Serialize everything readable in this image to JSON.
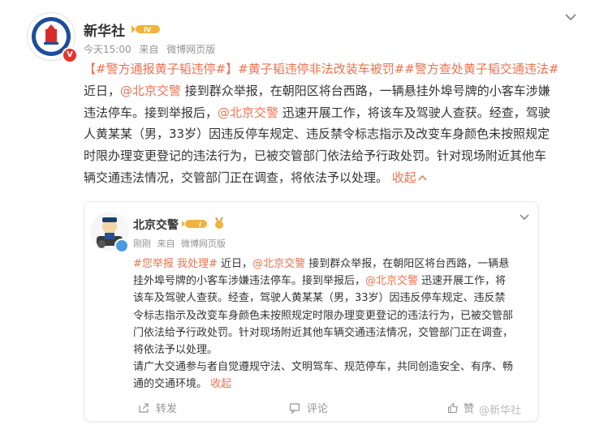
{
  "post": {
    "author": "新华社",
    "level_badge": "IV",
    "meta": {
      "time": "今天15:00",
      "source_prefix": "来自",
      "source": "微博网页版"
    },
    "text_lines": [
      [
        {
          "type": "tag",
          "text": "【#警方通报黄子韬违停#】"
        },
        {
          "type": "tag",
          "text": "#黄子韬违停非法改装车被罚#"
        },
        {
          "type": "tag",
          "text": "#警方查处黄子韬交通违法#"
        }
      ],
      [
        {
          "type": "text",
          "text": "近日，"
        },
        {
          "type": "link",
          "text": "@北京交警"
        },
        {
          "type": "text",
          "text": " 接到群众举报，在朝阳区将台西路，一辆悬挂外埠号牌的小客车涉嫌"
        }
      ],
      [
        {
          "type": "text",
          "text": "违法停车。接到举报后，"
        },
        {
          "type": "link",
          "text": "@北京交警"
        },
        {
          "type": "text",
          "text": " 迅速开展工作，将该车及驾驶人查获。经查，驾驶"
        }
      ],
      [
        {
          "type": "text",
          "text": "人黄某某（男，33岁）因违反停车规定、违反禁令标志指示及改变车身颜色未按照规定"
        }
      ],
      [
        {
          "type": "text",
          "text": "时限办理变更登记的违法行为，已被交管部门依法给予行政处罚。针对现场附近其他车"
        }
      ],
      [
        {
          "type": "text",
          "text": "辆交通违法情况，交管部门正在调查，将依法予以处理。 "
        },
        {
          "type": "collapse",
          "text": "收起"
        }
      ]
    ]
  },
  "quoted": {
    "author": "北京交警",
    "level_badge": "i",
    "meta": {
      "time": "刚刚",
      "source_prefix": "来自",
      "source": "微博网页版"
    },
    "text_lines": [
      [
        {
          "type": "tag",
          "text": "#您举报 我处理#"
        },
        {
          "type": "text",
          "text": " 近日，"
        },
        {
          "type": "link",
          "text": "@北京交警"
        },
        {
          "type": "text",
          "text": " 接到群众举报，在朝阳区将台西路，一辆悬"
        }
      ],
      [
        {
          "type": "text",
          "text": "挂外埠号牌的小客车涉嫌违法停车。接到举报后，"
        },
        {
          "type": "link",
          "text": "@北京交警"
        },
        {
          "type": "text",
          "text": " 迅速开展工作，将"
        }
      ],
      [
        {
          "type": "text",
          "text": "该车及驾驶人查获。经查，驾驶人黄某某（男，33岁）因违反停车规定、违反禁"
        }
      ],
      [
        {
          "type": "text",
          "text": "令标志指示及改变车身颜色未按照规定时限办理变更登记的违法行为，已被交管部"
        }
      ],
      [
        {
          "type": "text",
          "text": "门依法给予行政处罚。针对现场附近其他车辆交通违法情况，交管部门正在调查，"
        }
      ],
      [
        {
          "type": "text",
          "text": "将依法予以处理。"
        }
      ],
      [
        {
          "type": "text",
          "text": "请广大交通参与者自觉遵规守法、文明驾车、规范停车，共同创造安全、有序、畅"
        }
      ],
      [
        {
          "type": "text",
          "text": "通的交通环境。 "
        },
        {
          "type": "collapse",
          "text": "收起"
        }
      ]
    ],
    "actions": {
      "repost": "转发",
      "comment": "评论",
      "like": "赞"
    }
  },
  "watermark": "@新华社",
  "colors": {
    "accent": "#eb7350",
    "meta": "#939393",
    "badge_red": "#e8322a",
    "badge_blue": "#4a9be0"
  }
}
